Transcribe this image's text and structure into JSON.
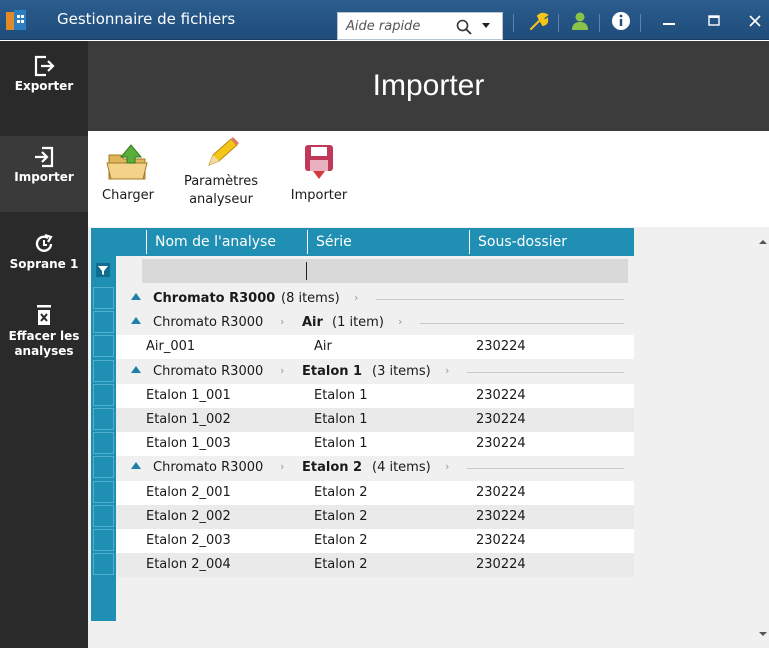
{
  "window": {
    "title": "Gestionnaire de fichiers",
    "search_placeholder": "Aide rapide"
  },
  "nav": {
    "items": [
      {
        "label": "Exporter",
        "icon": "export-icon"
      },
      {
        "label": "Importer",
        "icon": "import-icon"
      },
      {
        "label": "Soprane 1",
        "icon": "refresh-icon"
      },
      {
        "label": "Effacer les analyses",
        "icon": "delete-icon"
      }
    ],
    "active": "Importer"
  },
  "header": {
    "title": "Importer"
  },
  "toolbar": {
    "charger": "Charger",
    "parametres_line1": "Paramètres",
    "parametres_line2": "analyseur",
    "importer": "Importer"
  },
  "grid": {
    "columns": [
      "Nom de l'analyse",
      "Série",
      "Sous-dossier"
    ],
    "rows": [
      {
        "kind": "group",
        "path": [],
        "name": "Chromato R3000",
        "count": "(8 items)"
      },
      {
        "kind": "group",
        "path": [
          "Chromato R3000"
        ],
        "name": "Air",
        "count": "(1 item)"
      },
      {
        "kind": "data",
        "name": "Air_001",
        "serie": "Air",
        "sous": "230224"
      },
      {
        "kind": "group",
        "path": [
          "Chromato R3000"
        ],
        "name": "Etalon 1",
        "count": "(3 items)"
      },
      {
        "kind": "data",
        "name": "Etalon 1_001",
        "serie": "Etalon 1",
        "sous": "230224"
      },
      {
        "kind": "data",
        "name": "Etalon 1_002",
        "serie": "Etalon 1",
        "sous": "230224"
      },
      {
        "kind": "data",
        "name": "Etalon 1_003",
        "serie": "Etalon 1",
        "sous": "230224"
      },
      {
        "kind": "group",
        "path": [
          "Chromato R3000"
        ],
        "name": "Etalon 2",
        "count": "(4 items)"
      },
      {
        "kind": "data",
        "name": "Etalon 2_001",
        "serie": "Etalon 2",
        "sous": "230224"
      },
      {
        "kind": "data",
        "name": "Etalon 2_002",
        "serie": "Etalon 2",
        "sous": "230224"
      },
      {
        "kind": "data",
        "name": "Etalon 2_003",
        "serie": "Etalon 2",
        "sous": "230224"
      },
      {
        "kind": "data",
        "name": "Etalon 2_004",
        "serie": "Etalon 2",
        "sous": "230224"
      }
    ]
  },
  "colors": {
    "titlebar": "#2b5d8e",
    "nav_bg": "#2a2a2a",
    "header_bg": "#3c3c3c",
    "grid_header": "#1f8fb3",
    "title_accent_yellow": "#f5c518",
    "title_accent_green": "#8bc34a"
  }
}
